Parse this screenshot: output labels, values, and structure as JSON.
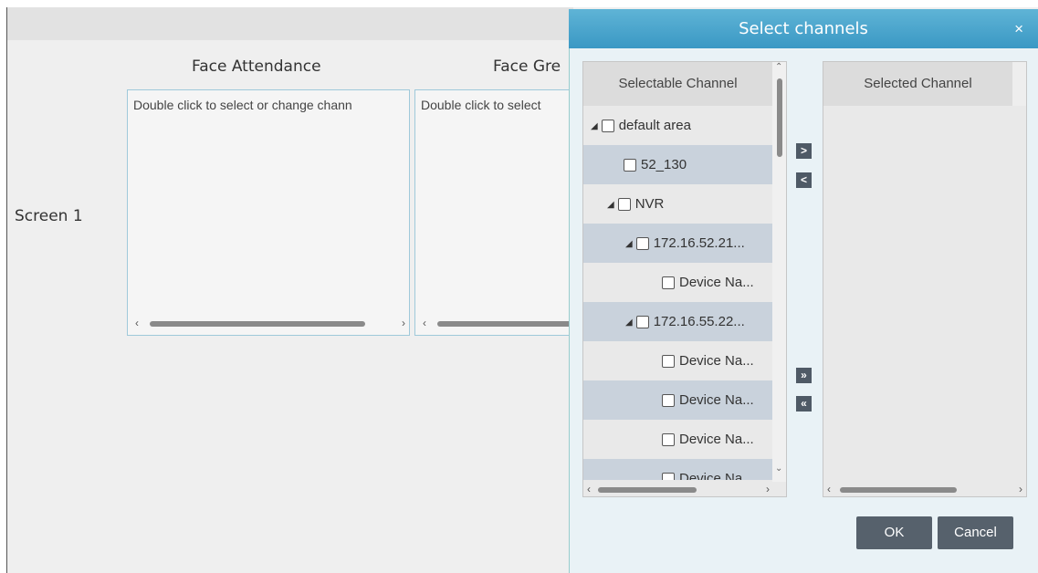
{
  "background": {
    "columns": [
      "Face Attendance",
      "Face Gre"
    ],
    "screen_label": "Screen 1",
    "panels": [
      {
        "hint": "Double click to select or change chann"
      },
      {
        "hint": "Double click to select"
      }
    ]
  },
  "dialog": {
    "title": "Select channels",
    "close_glyph": "×",
    "selectable_header": "Selectable Channel",
    "selected_header": "Selected Channel",
    "tree": [
      {
        "label": "default area",
        "level": 0,
        "expand": "◢"
      },
      {
        "label": "52_130",
        "level": 1,
        "expand": ""
      },
      {
        "label": "NVR",
        "level": 1,
        "expand": "◢"
      },
      {
        "label": "172.16.52.21...",
        "level": 2,
        "expand": "◢"
      },
      {
        "label": "Device Na...",
        "level": 3,
        "expand": ""
      },
      {
        "label": "172.16.55.22...",
        "level": 2,
        "expand": "◢"
      },
      {
        "label": "Device Na...",
        "level": 3,
        "expand": ""
      },
      {
        "label": "Device Na...",
        "level": 3,
        "expand": ""
      },
      {
        "label": "Device Na...",
        "level": 3,
        "expand": ""
      },
      {
        "label": "Device Na...",
        "level": 3,
        "expand": ""
      }
    ],
    "move_buttons": {
      "add": ">",
      "remove": "<",
      "add_all": "»",
      "remove_all": "«"
    },
    "ok_label": "OK",
    "cancel_label": "Cancel"
  },
  "colors": {
    "title_bar": "#3a98c4",
    "button": "#56616c",
    "row_alt": "#c9d2dc"
  }
}
